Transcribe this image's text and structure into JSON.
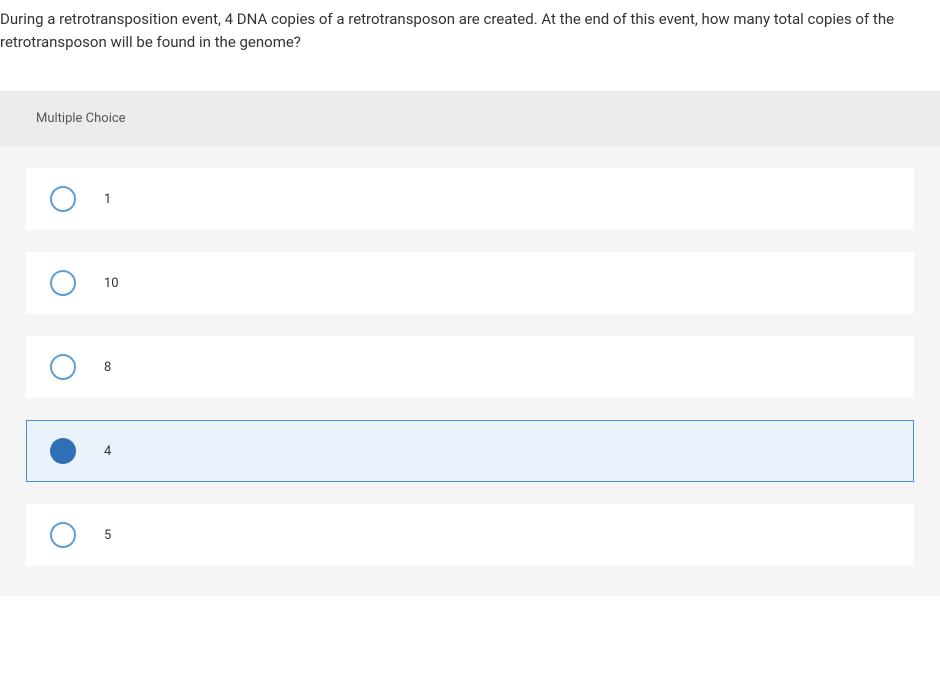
{
  "question": {
    "text": "During a retrotransposition event, 4 DNA copies of a retrotransposon are created. At the end of this event, how many total copies of the retrotransposon will be found in the genome?"
  },
  "quiz": {
    "header": "Multiple Choice",
    "selected_index": 3,
    "options": [
      {
        "label": "1"
      },
      {
        "label": "10"
      },
      {
        "label": "8"
      },
      {
        "label": "4"
      },
      {
        "label": "5"
      }
    ]
  }
}
